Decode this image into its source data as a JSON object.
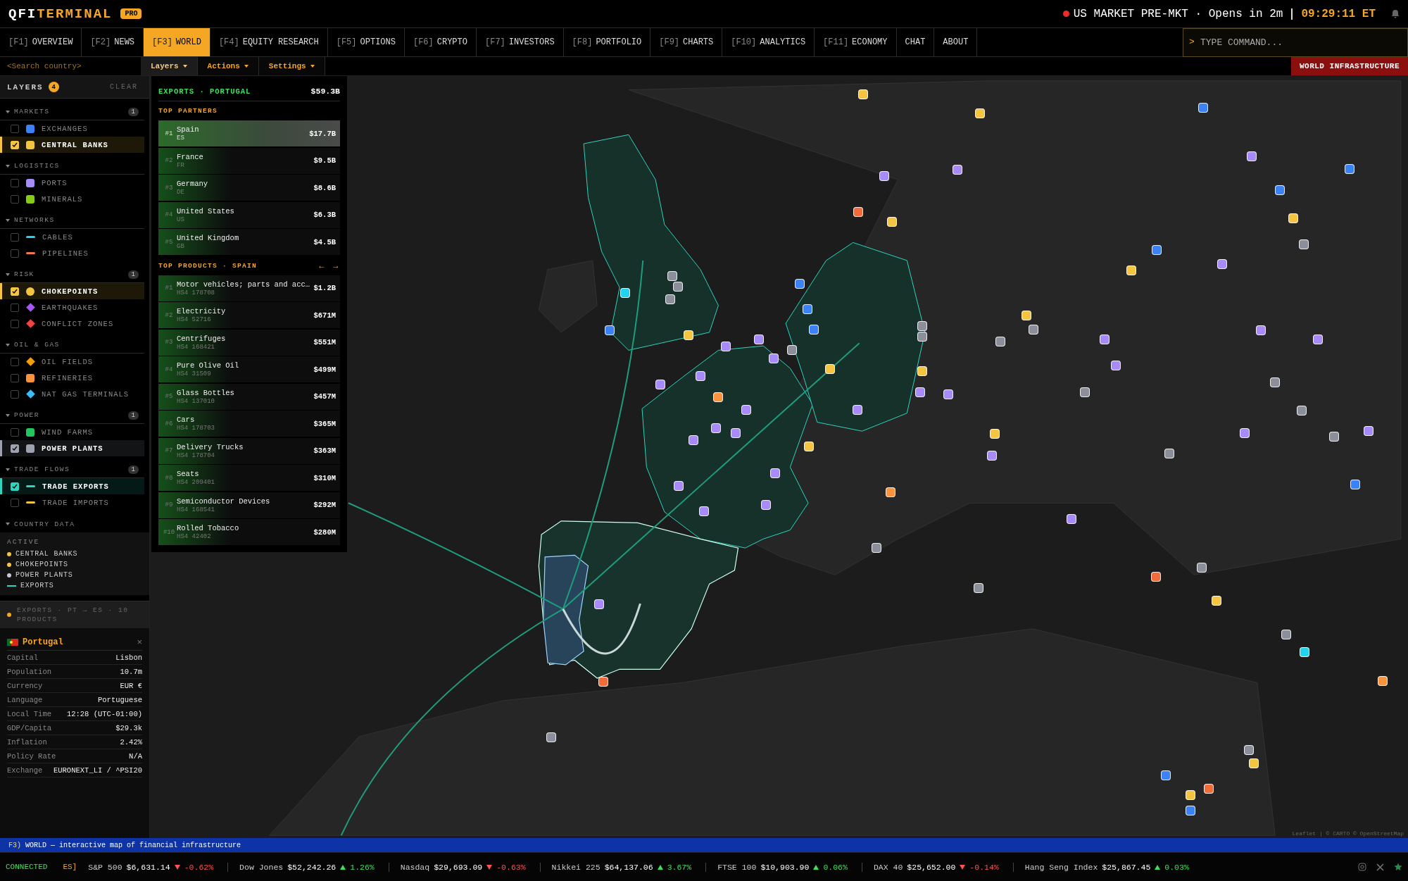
{
  "brand": {
    "left": "QFI",
    "right": "TERMINAL",
    "badge": "PRO"
  },
  "market_status": {
    "text": "US MARKET PRE-MKT · Opens in 2m",
    "time": "09:29:11 ET"
  },
  "nav_tabs": [
    {
      "key": "[F1]",
      "label": "OVERVIEW",
      "selected": false
    },
    {
      "key": "[F2]",
      "label": "NEWS",
      "selected": false
    },
    {
      "key": "[F3]",
      "label": "WORLD",
      "selected": true
    },
    {
      "key": "[F4]",
      "label": "EQUITY RESEARCH",
      "selected": false
    },
    {
      "key": "[F5]",
      "label": "OPTIONS",
      "selected": false
    },
    {
      "key": "[F6]",
      "label": "CRYPTO",
      "selected": false
    },
    {
      "key": "[F7]",
      "label": "INVESTORS",
      "selected": false
    },
    {
      "key": "[F8]",
      "label": "PORTFOLIO",
      "selected": false
    },
    {
      "key": "[F9]",
      "label": "CHARTS",
      "selected": false
    },
    {
      "key": "[F10]",
      "label": "ANALYTICS",
      "selected": false
    },
    {
      "key": "[F11]",
      "label": "ECONOMY",
      "selected": false
    },
    {
      "label": "CHAT",
      "selected": false
    },
    {
      "label": "ABOUT",
      "selected": false
    }
  ],
  "command": {
    "prompt": ">",
    "placeholder": "TYPE COMMAND..."
  },
  "country_search": {
    "placeholder": "<Search country>"
  },
  "sub_tabs": [
    {
      "label": "Layers",
      "selected": true
    },
    {
      "label": "Actions",
      "selected": false
    },
    {
      "label": "Settings",
      "selected": false
    }
  ],
  "overlay_badge": "WORLD INFRASTRUCTURE",
  "layers": {
    "title": "LAYERS",
    "count": "4",
    "clear": "CLEAR",
    "groups": [
      {
        "name": "MARKETS",
        "count": "1",
        "items": [
          {
            "label": "EXCHANGES",
            "checked": false,
            "kind": "square",
            "color": "#3b82f6"
          },
          {
            "label": "CENTRAL BANKS",
            "checked": true,
            "kind": "square",
            "color": "#f5c542"
          }
        ]
      },
      {
        "name": "LOGISTICS",
        "items": [
          {
            "label": "PORTS",
            "checked": false,
            "kind": "square",
            "color": "#a78bfa"
          },
          {
            "label": "MINERALS",
            "checked": false,
            "kind": "square",
            "color": "#84cc16"
          }
        ]
      },
      {
        "name": "NETWORKS",
        "items": [
          {
            "label": "CABLES",
            "checked": false,
            "kind": "line",
            "color": "#22d3ee"
          },
          {
            "label": "PIPELINES",
            "checked": false,
            "kind": "line",
            "color": "#f97352"
          }
        ]
      },
      {
        "name": "RISK",
        "count": "1",
        "items": [
          {
            "label": "CHOKEPOINTS",
            "checked": true,
            "kind": "circle",
            "color": "#f5c542"
          },
          {
            "label": "EARTHQUAKES",
            "checked": false,
            "kind": "diamond",
            "color": "#a855f7"
          },
          {
            "label": "CONFLICT ZONES",
            "checked": false,
            "kind": "diamond",
            "color": "#ef4444"
          }
        ]
      },
      {
        "name": "OIL & GAS",
        "items": [
          {
            "label": "OIL FIELDS",
            "checked": false,
            "kind": "diamond",
            "color": "#f59e0b"
          },
          {
            "label": "REFINERIES",
            "checked": false,
            "kind": "square",
            "color": "#fb923c"
          },
          {
            "label": "NAT GAS TERMINALS",
            "checked": false,
            "kind": "diamond",
            "color": "#38bdf8"
          }
        ]
      },
      {
        "name": "POWER",
        "count": "1",
        "items": [
          {
            "label": "WIND FARMS",
            "checked": false,
            "kind": "square",
            "color": "#22c55e"
          },
          {
            "label": "POWER PLANTS",
            "checked": true,
            "kind": "square",
            "color": "#9ca3af"
          }
        ]
      },
      {
        "name": "TRADE FLOWS",
        "count": "1",
        "items": [
          {
            "label": "TRADE EXPORTS",
            "checked": true,
            "kind": "line",
            "color": "#2dd4bf"
          },
          {
            "label": "TRADE IMPORTS",
            "checked": false,
            "kind": "line",
            "color": "#f5c542"
          }
        ]
      }
    ]
  },
  "country_data": {
    "title": "COUNTRY DATA",
    "active_title": "ACTIVE",
    "active": [
      {
        "label": "CENTRAL BANKS",
        "kind": "dot",
        "color": "#f5c542"
      },
      {
        "label": "CHOKEPOINTS",
        "kind": "dot",
        "color": "#f5c542"
      },
      {
        "label": "POWER PLANTS",
        "kind": "dot",
        "color": "#c7cad6"
      },
      {
        "label": "EXPORTS",
        "kind": "line",
        "color": "#2dd4bf"
      }
    ]
  },
  "flow_status": "EXPORTS · PT → ES · 10 PRODUCTS",
  "country_card": {
    "name": "Portugal",
    "close": "×",
    "rows": [
      {
        "label": "Capital",
        "value": "Lisbon"
      },
      {
        "label": "Population",
        "value": "10.7m"
      },
      {
        "label": "Currency",
        "value": "EUR €"
      },
      {
        "label": "Language",
        "value": "Portuguese"
      },
      {
        "label": "Local Time",
        "value": "12:28 (UTC-01:00)"
      },
      {
        "label": "GDP/Capita",
        "value": "$29.3k"
      },
      {
        "label": "Inflation",
        "value": "2.42%"
      },
      {
        "label": "Policy Rate",
        "value": "N/A"
      },
      {
        "label": "Exchange",
        "value": "EURONEXT_LI / ^PSI20"
      }
    ]
  },
  "exports_panel": {
    "title": "EXPORTS · PORTUGAL",
    "total": "$59.3B",
    "partners_title": "TOP PARTNERS",
    "partners": [
      {
        "rank": "#1",
        "name": "Spain",
        "code": "ES",
        "value": "$17.7B",
        "selected": true
      },
      {
        "rank": "#2",
        "name": "France",
        "code": "FR",
        "value": "$9.5B",
        "selected": false
      },
      {
        "rank": "#3",
        "name": "Germany",
        "code": "DE",
        "value": "$8.6B",
        "selected": false
      },
      {
        "rank": "#4",
        "name": "United States",
        "code": "US",
        "value": "$6.3B",
        "selected": false
      },
      {
        "rank": "#5",
        "name": "United Kingdom",
        "code": "GB",
        "value": "$4.5B",
        "selected": false
      }
    ],
    "products_title": "TOP PRODUCTS · SPAIN",
    "prev": "←",
    "next": "→",
    "products": [
      {
        "rank": "#1",
        "name": "Motor vehicles; parts and acc…",
        "code": "HS4 178708",
        "value": "$1.2B"
      },
      {
        "rank": "#2",
        "name": "Electricity",
        "code": "HS4 52716",
        "value": "$671M"
      },
      {
        "rank": "#3",
        "name": "Centrifuges",
        "code": "HS4 168421",
        "value": "$551M"
      },
      {
        "rank": "#4",
        "name": "Pure Olive Oil",
        "code": "HS4 31509",
        "value": "$499M"
      },
      {
        "rank": "#5",
        "name": "Glass Bottles",
        "code": "HS4 137010",
        "value": "$457M"
      },
      {
        "rank": "#6",
        "name": "Cars",
        "code": "HS4 178703",
        "value": "$365M"
      },
      {
        "rank": "#7",
        "name": "Delivery Trucks",
        "code": "HS4 178704",
        "value": "$363M"
      },
      {
        "rank": "#8",
        "name": "Seats",
        "code": "HS4 209401",
        "value": "$310M"
      },
      {
        "rank": "#9",
        "name": "Semiconductor Devices",
        "code": "HS4 168541",
        "value": "$292M"
      },
      {
        "rank": "#10",
        "name": "Rolled Tobacco",
        "code": "HS4 42402",
        "value": "$280M"
      }
    ]
  },
  "map": {
    "attribution": "Leaflet | © CARTO © OpenStreetMap"
  },
  "status_line": {
    "key": "F3)",
    "text": "WORLD — interactive map of financial infrastructure"
  },
  "ticker": {
    "connection": "CONNECTED",
    "fragment": "ES]",
    "items": [
      {
        "name": "S&P 500",
        "price": "$6,631.14",
        "change": "-0.62%",
        "rising": false
      },
      {
        "name": "Dow Jones",
        "price": "$52,242.26",
        "change": "1.26%",
        "rising": true
      },
      {
        "name": "Nasdaq",
        "price": "$29,693.09",
        "change": "-0.63%",
        "rising": false
      },
      {
        "name": "Nikkei 225",
        "price": "$64,137.06",
        "change": "3.67%",
        "rising": true
      },
      {
        "name": "FTSE 100",
        "price": "$10,903.90",
        "change": "0.06%",
        "rising": true
      },
      {
        "name": "DAX 40",
        "price": "$25,652.00",
        "change": "-0.14%",
        "rising": false
      },
      {
        "name": "Hang Seng Index",
        "price": "$25,867.45",
        "change": "0.03%",
        "rising": true
      }
    ]
  }
}
